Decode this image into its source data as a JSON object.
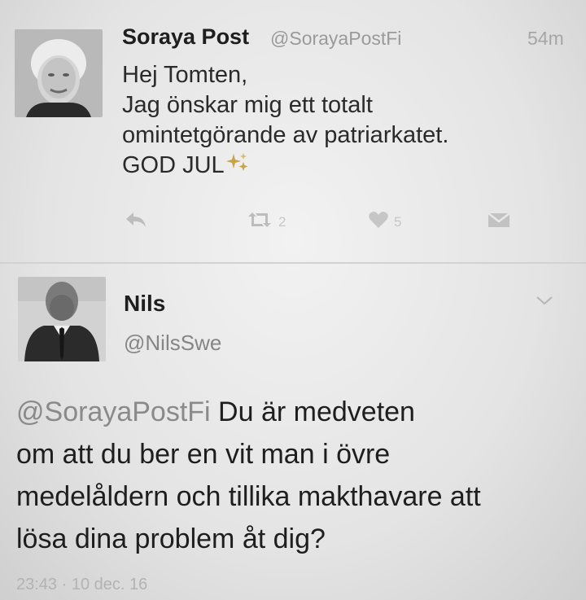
{
  "tweet1": {
    "name": "Soraya Post",
    "handle": "@SorayaPostFi",
    "time": "54m",
    "lines": [
      "Hej Tomten,",
      "Jag önskar mig ett totalt",
      "omintetgörande av patriarkatet.",
      "GOD JUL"
    ],
    "retweet_count": "2",
    "like_count": "5",
    "icons": {
      "reply": "reply-icon",
      "retweet": "retweet-icon",
      "like": "heart-icon",
      "dm": "envelope-icon",
      "emoji": "sparkles-icon"
    }
  },
  "tweet2": {
    "name": "Nils",
    "handle": "@NilsSwe",
    "mention": "@SorayaPostFi",
    "line1_rest": " Du är medveten",
    "lines": [
      "om att du ber en vit man i övre",
      "medelåldern och tillika makthavare att",
      "lösa dina problem åt dig?"
    ],
    "timestamp": "23:43 · 10 dec. 16",
    "icons": {
      "menu": "chevron-down-icon"
    }
  },
  "colors": {
    "background": "#e6e6e6",
    "text": "#1b1b1b",
    "muted": "#9a9a9a",
    "sparkle": "#c9a24a"
  }
}
